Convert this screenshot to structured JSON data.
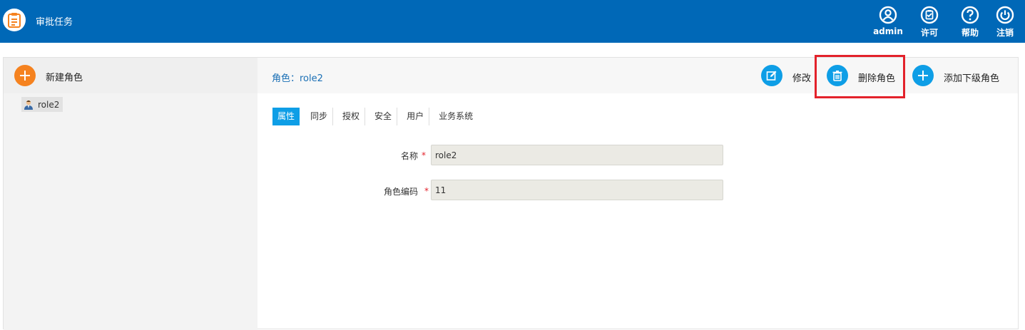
{
  "header": {
    "app_title": "审批任务",
    "actions": [
      {
        "label": "admin",
        "icon": "user-icon"
      },
      {
        "label": "许可",
        "icon": "license-icon"
      },
      {
        "label": "帮助",
        "icon": "help-icon"
      },
      {
        "label": "注销",
        "icon": "power-icon"
      }
    ]
  },
  "sidebar": {
    "new_role_label": "新建角色",
    "tree": [
      {
        "label": "role2"
      }
    ]
  },
  "main": {
    "role_title": "角色：role2",
    "toolbar": {
      "edit_label": "修改",
      "delete_label": "删除角色",
      "add_child_label": "添加下级角色"
    },
    "tabs": [
      "属性",
      "同步",
      "授权",
      "安全",
      "用户",
      "业务系统"
    ],
    "active_tab": "属性",
    "form": {
      "name_label": "名称",
      "name_value": "role2",
      "code_label": "角色编码",
      "code_value": "11",
      "required_mark": "*"
    }
  },
  "colors": {
    "header_bg": "#0068b7",
    "accent_blue": "#0e9ee6",
    "accent_orange": "#f5821f",
    "highlight_red": "#e3222b"
  }
}
